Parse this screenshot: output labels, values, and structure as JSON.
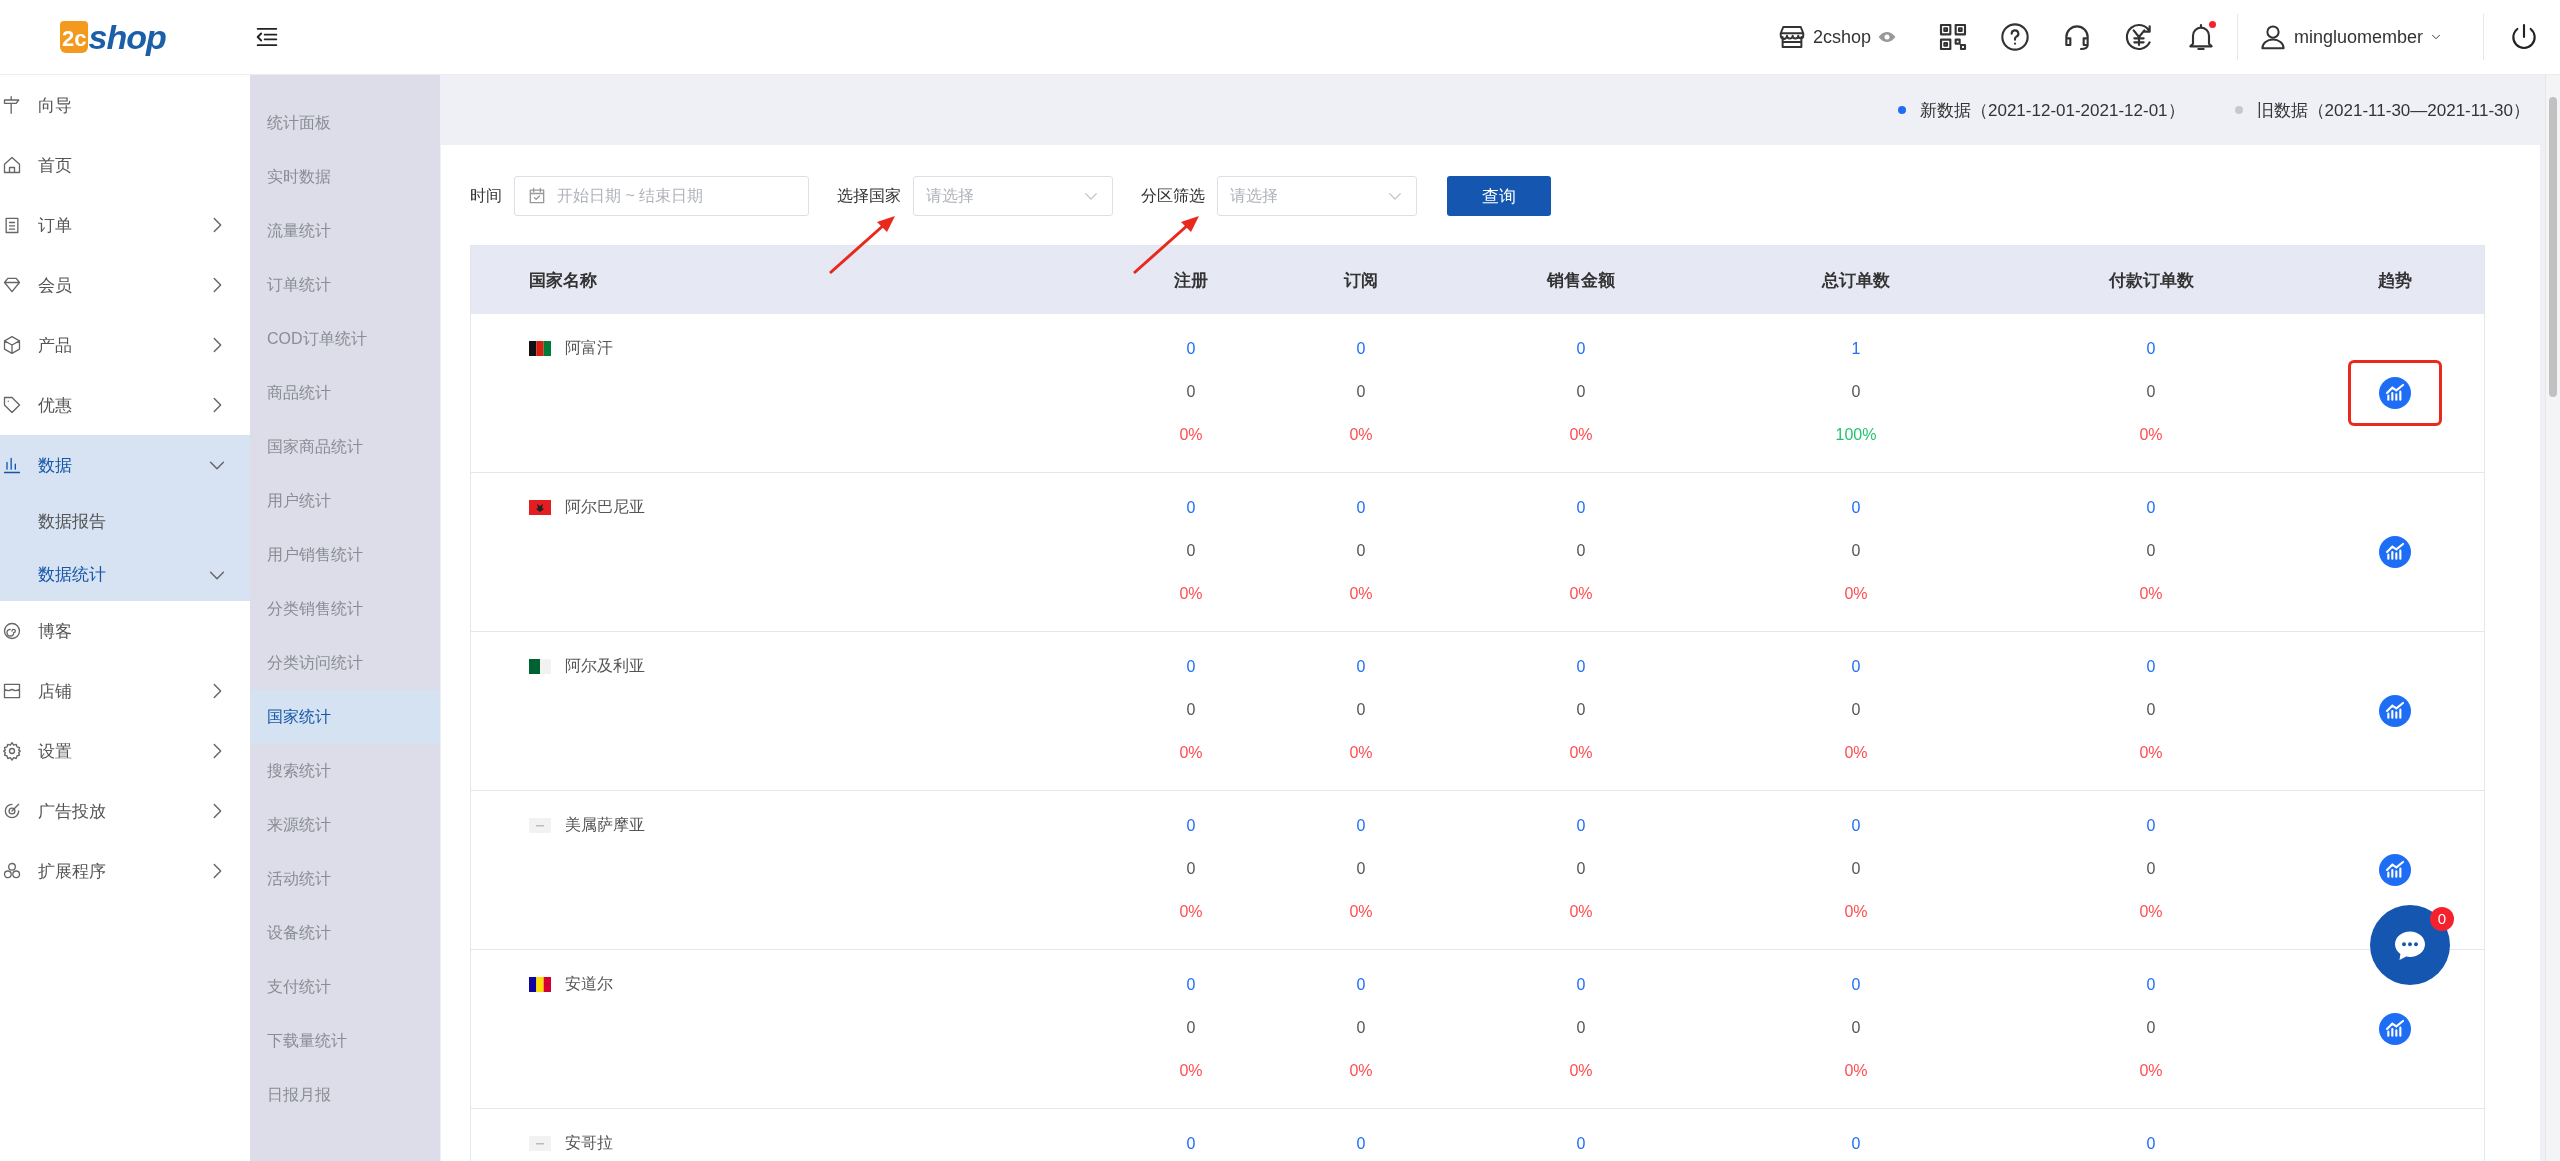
{
  "header": {
    "logo": {
      "mark": "2c",
      "text": "shop"
    },
    "store": "2cshop",
    "notification": true,
    "user": "mingluomember"
  },
  "sidebar": {
    "items": [
      {
        "label": "向导",
        "selected": false
      },
      {
        "label": "首页",
        "selected": false
      },
      {
        "label": "订单",
        "selected": false,
        "expanded": false
      },
      {
        "label": "会员",
        "selected": false,
        "expanded": false
      },
      {
        "label": "产品",
        "selected": false,
        "expanded": false
      },
      {
        "label": "优惠",
        "selected": false,
        "expanded": false
      },
      {
        "label": "数据",
        "selected": true,
        "expanded": true,
        "children": [
          {
            "label": "数据报告",
            "selected": false
          },
          {
            "label": "数据统计",
            "selected": true,
            "expanded": true
          }
        ]
      },
      {
        "label": "博客",
        "selected": false
      },
      {
        "label": "店铺",
        "selected": false,
        "expanded": false
      },
      {
        "label": "设置",
        "selected": false,
        "expanded": false
      },
      {
        "label": "广告投放",
        "selected": false,
        "expanded": false
      },
      {
        "label": "扩展程序",
        "selected": false,
        "expanded": false
      }
    ]
  },
  "submenu": {
    "items": [
      {
        "label": "统计面板",
        "selected": false
      },
      {
        "label": "实时数据",
        "selected": false
      },
      {
        "label": "流量统计",
        "selected": false
      },
      {
        "label": "订单统计",
        "selected": false
      },
      {
        "label": "COD订单统计",
        "selected": false
      },
      {
        "label": "商品统计",
        "selected": false
      },
      {
        "label": "国家商品统计",
        "selected": false
      },
      {
        "label": "用户统计",
        "selected": false
      },
      {
        "label": "用户销售统计",
        "selected": false
      },
      {
        "label": "分类销售统计",
        "selected": false
      },
      {
        "label": "分类访问统计",
        "selected": false
      },
      {
        "label": "国家统计",
        "selected": true
      },
      {
        "label": "搜索统计",
        "selected": false
      },
      {
        "label": "来源统计",
        "selected": false
      },
      {
        "label": "活动统计",
        "selected": false
      },
      {
        "label": "设备统计",
        "selected": false
      },
      {
        "label": "支付统计",
        "selected": false
      },
      {
        "label": "下载量统计",
        "selected": false
      },
      {
        "label": "日报月报",
        "selected": false
      }
    ]
  },
  "legend": [
    {
      "label": "新数据（2021-12-01-2021-12-01）",
      "color": "#1e6ef5"
    },
    {
      "label": "旧数据（2021-11-30—2021-11-30）",
      "color": "#c8c8c8"
    }
  ],
  "filters": {
    "fields": [
      {
        "kind": "date",
        "label": "时间",
        "placeholder": "开始日期 ~ 结束日期",
        "annotated": false
      },
      {
        "kind": "select",
        "label": "选择国家",
        "placeholder": "请选择",
        "annotated": true
      },
      {
        "kind": "select",
        "label": "分区筛选",
        "placeholder": "请选择",
        "annotated": true
      }
    ],
    "query_button": "查询"
  },
  "table": {
    "columns": [
      "国家名称",
      "注册",
      "订阅",
      "销售金额",
      "总订单数",
      "付款订单数",
      "趋势"
    ],
    "rows": [
      {
        "country": "阿富汗",
        "flag": {
          "kind": "vertical",
          "parts": [
            {
              "color": "#111111"
            },
            {
              "color": "#d32011"
            },
            {
              "color": "#007a36"
            }
          ]
        },
        "trend": {
          "highlighted": true
        },
        "values": [
          {
            "new": "0",
            "old": "0",
            "change": "0%",
            "color": "#ff4d4f"
          },
          {
            "new": "0",
            "old": "0",
            "change": "0%",
            "color": "#ff4d4f"
          },
          {
            "new": "0",
            "old": "0",
            "change": "0%",
            "color": "#ff4d4f"
          },
          {
            "new": "1",
            "old": "0",
            "change": "100%",
            "color": "#22c46e"
          },
          {
            "new": "0",
            "old": "0",
            "change": "0%",
            "color": "#ff4d4f"
          }
        ]
      },
      {
        "country": "阿尔巴尼亚",
        "flag": {
          "kind": "emblem",
          "parts": [
            {
              "color": "#e41e20"
            },
            {
              "color": "#222222"
            }
          ]
        },
        "trend": {
          "highlighted": false
        },
        "values": [
          {
            "new": "0",
            "old": "0",
            "change": "0%",
            "color": "#ff4d4f"
          },
          {
            "new": "0",
            "old": "0",
            "change": "0%",
            "color": "#ff4d4f"
          },
          {
            "new": "0",
            "old": "0",
            "change": "0%",
            "color": "#ff4d4f"
          },
          {
            "new": "0",
            "old": "0",
            "change": "0%",
            "color": "#ff4d4f"
          },
          {
            "new": "0",
            "old": "0",
            "change": "0%",
            "color": "#ff4d4f"
          }
        ]
      },
      {
        "country": "阿尔及利亚",
        "flag": {
          "kind": "vertical",
          "parts": [
            {
              "color": "#006233"
            },
            {
              "color": "#f2f2f2"
            }
          ]
        },
        "trend": {
          "highlighted": false
        },
        "values": [
          {
            "new": "0",
            "old": "0",
            "change": "0%",
            "color": "#ff4d4f"
          },
          {
            "new": "0",
            "old": "0",
            "change": "0%",
            "color": "#ff4d4f"
          },
          {
            "new": "0",
            "old": "0",
            "change": "0%",
            "color": "#ff4d4f"
          },
          {
            "new": "0",
            "old": "0",
            "change": "0%",
            "color": "#ff4d4f"
          },
          {
            "new": "0",
            "old": "0",
            "change": "0%",
            "color": "#ff4d4f"
          }
        ]
      },
      {
        "country": "美属萨摩亚",
        "flag": {
          "kind": "placeholder"
        },
        "trend": {
          "highlighted": false
        },
        "values": [
          {
            "new": "0",
            "old": "0",
            "change": "0%",
            "color": "#ff4d4f"
          },
          {
            "new": "0",
            "old": "0",
            "change": "0%",
            "color": "#ff4d4f"
          },
          {
            "new": "0",
            "old": "0",
            "change": "0%",
            "color": "#ff4d4f"
          },
          {
            "new": "0",
            "old": "0",
            "change": "0%",
            "color": "#ff4d4f"
          },
          {
            "new": "0",
            "old": "0",
            "change": "0%",
            "color": "#ff4d4f"
          }
        ]
      },
      {
        "country": "安道尔",
        "flag": {
          "kind": "vertical",
          "parts": [
            {
              "color": "#10069f"
            },
            {
              "color": "#fedd00"
            },
            {
              "color": "#d50032"
            }
          ]
        },
        "trend": {
          "highlighted": false
        },
        "values": [
          {
            "new": "0",
            "old": "0",
            "change": "0%",
            "color": "#ff4d4f"
          },
          {
            "new": "0",
            "old": "0",
            "change": "0%",
            "color": "#ff4d4f"
          },
          {
            "new": "0",
            "old": "0",
            "change": "0%",
            "color": "#ff4d4f"
          },
          {
            "new": "0",
            "old": "0",
            "change": "0%",
            "color": "#ff4d4f"
          },
          {
            "new": "0",
            "old": "0",
            "change": "0%",
            "color": "#ff4d4f"
          }
        ]
      },
      {
        "country": "安哥拉",
        "flag": {
          "kind": "placeholder"
        },
        "values": [
          {
            "new": "0"
          },
          {
            "new": "0"
          },
          {
            "new": "0"
          },
          {
            "new": "0"
          },
          {
            "new": "0"
          }
        ]
      }
    ]
  },
  "chat": {
    "badge": "0"
  }
}
